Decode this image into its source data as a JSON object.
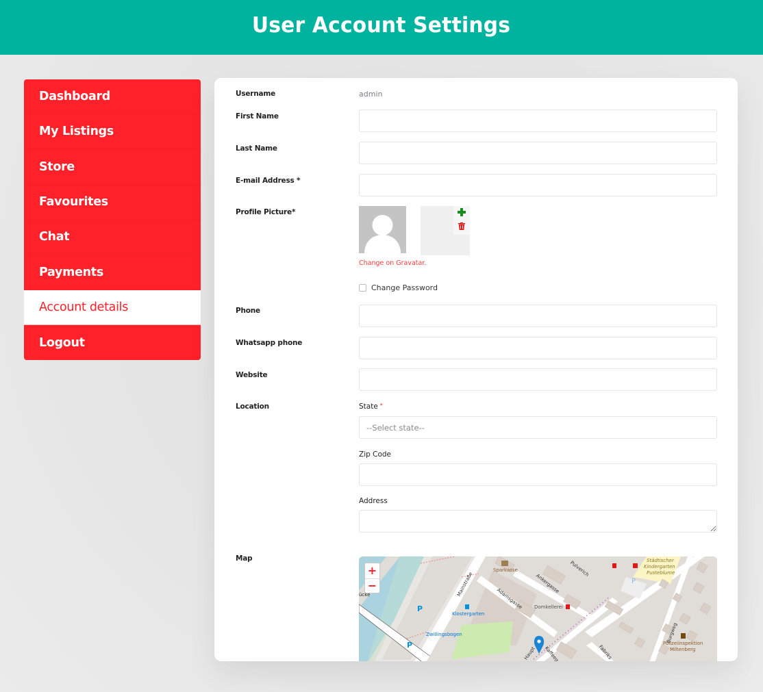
{
  "header": {
    "title": "User Account Settings"
  },
  "colors": {
    "header_bg": "#00b39f",
    "sidebar_bg": "#ff2129",
    "accent_red": "#ff2129",
    "link_red": "#ff3b3b"
  },
  "sidebar": {
    "items": [
      {
        "label": "Dashboard",
        "active": false
      },
      {
        "label": "My Listings",
        "active": false
      },
      {
        "label": "Store",
        "active": false
      },
      {
        "label": "Favourites",
        "active": false
      },
      {
        "label": "Chat",
        "active": false
      },
      {
        "label": "Payments",
        "active": false
      },
      {
        "label": "Account details",
        "active": true
      },
      {
        "label": "Logout",
        "active": false
      }
    ]
  },
  "form": {
    "username": {
      "label": "Username",
      "value": "admin"
    },
    "first_name": {
      "label": "First Name",
      "value": ""
    },
    "last_name": {
      "label": "Last Name",
      "value": ""
    },
    "email": {
      "label": "E-mail Address *",
      "value": ""
    },
    "profile_picture": {
      "label": "Profile Picture*",
      "gravatar_link": "Change on Gravatar.",
      "add_icon": "plus-icon",
      "delete_icon": "trash-icon"
    },
    "change_password": {
      "label": "Change Password",
      "checked": false
    },
    "phone": {
      "label": "Phone",
      "value": ""
    },
    "whatsapp": {
      "label": "Whatsapp phone",
      "value": ""
    },
    "website": {
      "label": "Website",
      "value": ""
    },
    "location": {
      "label": "Location",
      "state": {
        "label": "State",
        "required_mark": "*",
        "selected": "--Select state--"
      },
      "zip": {
        "label": "Zip Code",
        "value": ""
      },
      "address": {
        "label": "Address",
        "value": ""
      }
    },
    "map": {
      "label": "Map",
      "zoom_in": "+",
      "zoom_out": "−",
      "labels": {
        "sparkasse": "Sparkasse",
        "mainstrasse": "Mainstraße",
        "klostergarten": "Klostergarten",
        "zwillingsbogen": "Zwillingsbogen",
        "adamsgasse": "Adamsgasse",
        "ankergasse": "Ankergasse",
        "pulverich": "Pulverich",
        "domkellerei": "Domkellerei",
        "kindergarten1": "Städtischer",
        "kindergarten2": "Kindergarten",
        "kindergarten3": "Pusteblume",
        "burgweg": "Burgweg",
        "polizei1": "Polizeiinspektion",
        "polizei2": "Miltenberg",
        "bruecke": "ücke",
        "hauptstrasse": "Haupt",
        "kaffeegasse": "Kaffeeg",
        "fabrik": "Fabriks",
        "parking": "P"
      }
    }
  }
}
